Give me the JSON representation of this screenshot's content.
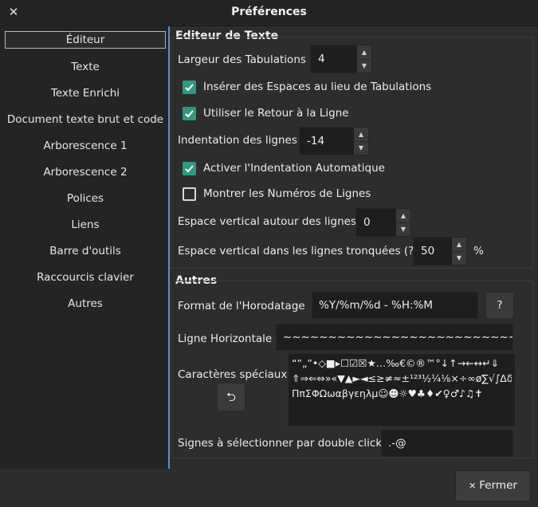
{
  "window": {
    "title": "Préférences",
    "close_glyph": "✕"
  },
  "sidebar": {
    "items": [
      {
        "label": "Éditeur"
      },
      {
        "label": "Texte"
      },
      {
        "label": "Texte Enrichi"
      },
      {
        "label": "Document texte brut et code"
      },
      {
        "label": "Arborescence 1"
      },
      {
        "label": "Arborescence 2"
      },
      {
        "label": "Polices"
      },
      {
        "label": "Liens"
      },
      {
        "label": "Barre d'outils"
      },
      {
        "label": "Raccourcis clavier"
      },
      {
        "label": "Autres"
      }
    ],
    "active_index": 0
  },
  "editor": {
    "section_title": "Editeur de Texte",
    "tab_width_label": "Largeur des Tabulations",
    "tab_width_value": "4",
    "insert_spaces_label": "Insérer des Espaces au lieu de Tabulations",
    "insert_spaces_checked": true,
    "word_wrap_label": "Utiliser le Retour à la Ligne",
    "word_wrap_checked": true,
    "line_indent_label": "Indentation des lignes",
    "line_indent_value": "-14",
    "auto_indent_label": "Activer l'Indentation Automatique",
    "auto_indent_checked": true,
    "line_numbers_label": "Montrer les Numéros de Lignes",
    "line_numbers_checked": false,
    "vspace_around_label": "Espace vertical autour des lignes",
    "vspace_around_value": "0",
    "vspace_wrapped_label": "Espace vertical dans les lignes tronquées (?)",
    "vspace_wrapped_value": "50",
    "vspace_wrapped_unit": "%"
  },
  "others": {
    "section_title": "Autres",
    "timestamp_label": "Format de l'Horodatage",
    "timestamp_value": "%Y/%m/%d - %H:%M",
    "timestamp_help": "?",
    "hrule_label": "Ligne Horizontale",
    "hrule_value": "~~~~~~~~~~~~~~~~~~~~~~~~~~~~~~~~~~~",
    "special_chars_label": "Caractères spéciaux",
    "special_chars_lines": [
      "“”„”•◇■▸☐☑☒★…‰€©®™°↓↑→←↔↵⇓",
      "⇑⇒⇐⇔»«▼▲►◄≤≥≠≈±¹²³½¼⅛×÷∞ø∑√∫Δδ",
      "ΠπΣΦΩωαβγεηλμ☺☻☼♥♣♦✔♀♂♪♫✝"
    ],
    "reset_icon": "⮌",
    "dblclick_label": "Signes à sélectionner par double click",
    "dblclick_value": ".-@"
  },
  "footer": {
    "close_icon": "✕",
    "close_label": "Fermer"
  },
  "colors": {
    "accent": "#2e9a82",
    "selection_line": "#5a8fc7"
  }
}
